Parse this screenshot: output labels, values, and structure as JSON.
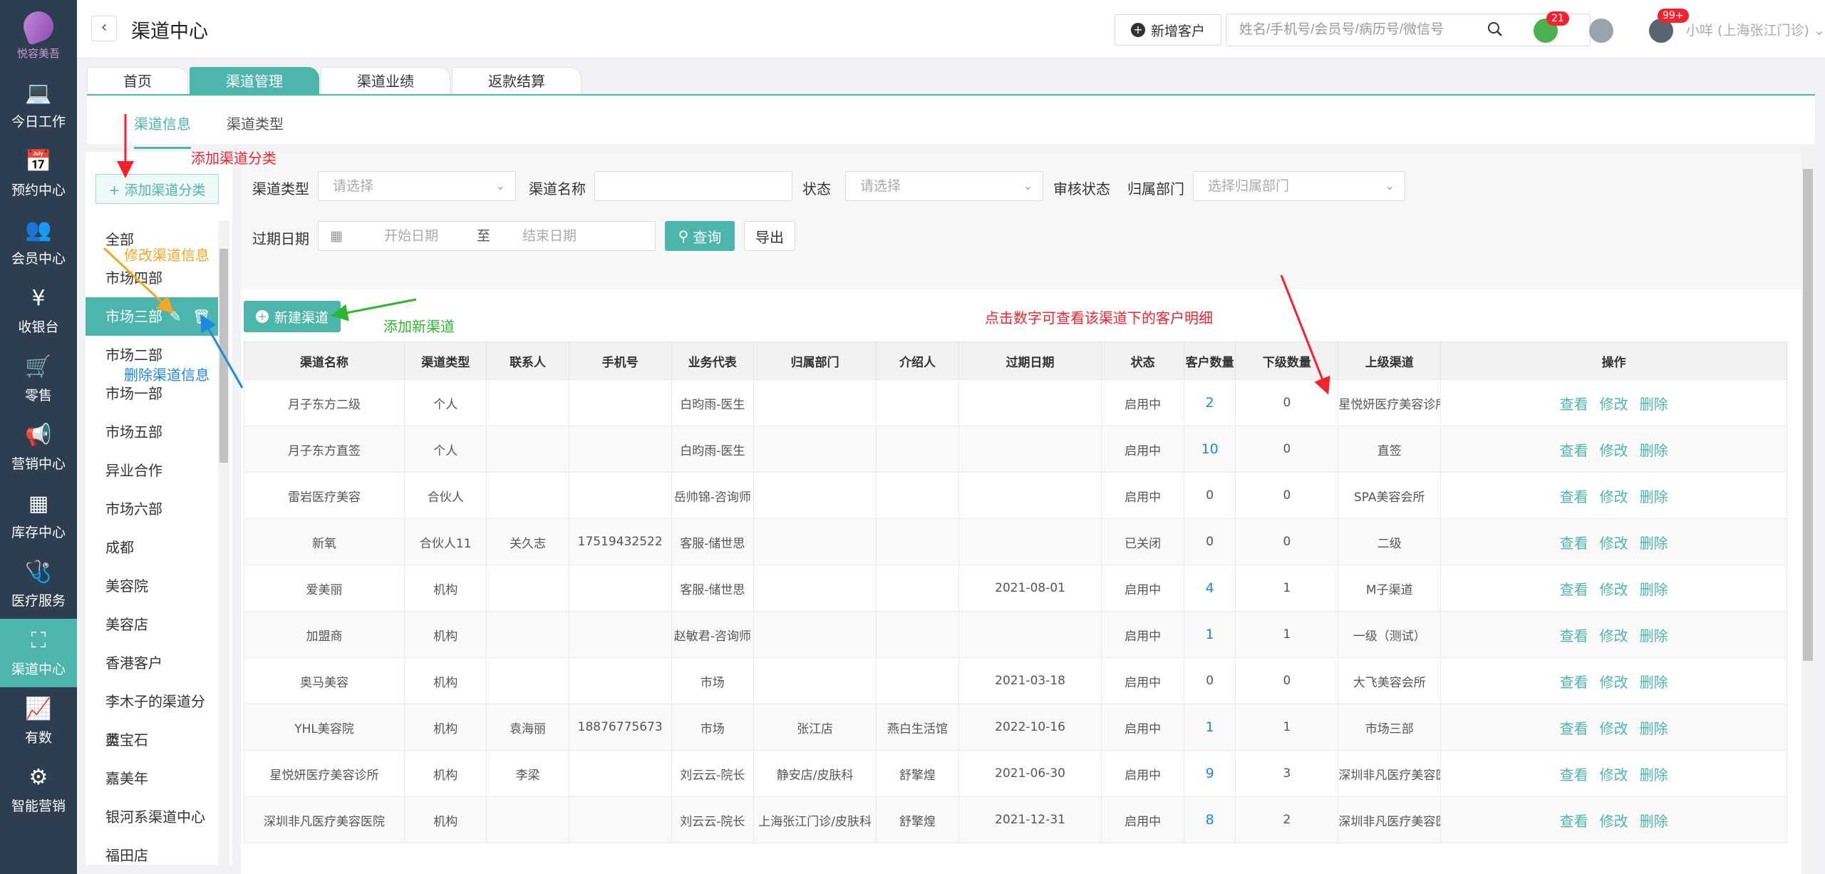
{
  "brand": {
    "logo_text": "悦容美吾"
  },
  "nav": [
    {
      "icon": "laptop-icon",
      "glyph": "💻",
      "label": "今日工作"
    },
    {
      "icon": "calendar-icon",
      "glyph": "📅",
      "label": "预约中心"
    },
    {
      "icon": "members-icon",
      "glyph": "👥",
      "label": "会员中心"
    },
    {
      "icon": "yen-icon",
      "glyph": "¥",
      "label": "收银台"
    },
    {
      "icon": "cart-icon",
      "glyph": "🛒",
      "label": "零售"
    },
    {
      "icon": "megaphone-icon",
      "glyph": "📢",
      "label": "营销中心"
    },
    {
      "icon": "grid-icon",
      "glyph": "▦",
      "label": "库存中心"
    },
    {
      "icon": "medical-kit-icon",
      "glyph": "🩺",
      "label": "医疗服务"
    },
    {
      "icon": "org-chart-icon",
      "glyph": "⛶",
      "label": "渠道中心"
    },
    {
      "icon": "trend-chart-icon",
      "glyph": "📈",
      "label": "有数"
    },
    {
      "icon": "smart-marketing-icon",
      "glyph": "⚙",
      "label": "智能营销"
    }
  ],
  "header": {
    "title": "渠道中心",
    "new_customer": "新增客户",
    "search_placeholder": "姓名/手机号/会员号/病历号/微信号",
    "badge_messages": "21",
    "badge_notifications": "99+",
    "user": "小咩 (上海张江门诊)"
  },
  "tabs": [
    "首页",
    "渠道管理",
    "渠道业绩",
    "返款结算"
  ],
  "subtabs": [
    "渠道信息",
    "渠道类型"
  ],
  "categories": {
    "add_button": "+ 添加渠道分类",
    "items": [
      "全部",
      "市场四部",
      "市场三部",
      "市场二部",
      "市场一部",
      "市场五部",
      "异业合作",
      "市场六部",
      "成都",
      "美容院",
      "美容店",
      "香港客户",
      "李木子的渠道分类",
      "蓝宝石",
      "嘉美年",
      "银河系渠道中心",
      "福田店"
    ]
  },
  "filters": {
    "type_label": "渠道类型",
    "type_placeholder": "请选择",
    "name_label": "渠道名称",
    "status_label": "状态",
    "status_placeholder": "请选择",
    "audit_label": "审核状态",
    "dept_label": "归属部门",
    "dept_placeholder": "选择归属部门",
    "expire_label": "过期日期",
    "start_placeholder": "开始日期",
    "to": "至",
    "end_placeholder": "结束日期",
    "query": "查询",
    "export": "导出"
  },
  "new_channel": "新建渠道",
  "table": {
    "headers": [
      "渠道名称",
      "渠道类型",
      "联系人",
      "手机号",
      "业务代表",
      "归属部门",
      "介绍人",
      "过期日期",
      "状态",
      "客户数量",
      "下级数量",
      "上级渠道",
      "操作"
    ],
    "actions": [
      "查看",
      "修改",
      "删除"
    ],
    "rows": [
      [
        "月子东方二级",
        "个人",
        "",
        "",
        "白昀雨-医生",
        "",
        "",
        "",
        "启用中",
        "2",
        "0",
        "星悦妍医疗美容诊所"
      ],
      [
        "月子东方直签",
        "个人",
        "",
        "",
        "白昀雨-医生",
        "",
        "",
        "",
        "启用中",
        "10",
        "0",
        "直签"
      ],
      [
        "雷岩医疗美容",
        "合伙人",
        "",
        "",
        "岳帅锦-咨询师",
        "",
        "",
        "",
        "启用中",
        "0",
        "0",
        "SPA美容会所"
      ],
      [
        "新氧",
        "合伙人11",
        "关久志",
        "17519432522",
        "客服-储世思",
        "",
        "",
        "",
        "已关闭",
        "0",
        "0",
        "二级"
      ],
      [
        "爱美丽",
        "机构",
        "",
        "",
        "客服-储世思",
        "",
        "",
        "2021-08-01",
        "启用中",
        "4",
        "1",
        "M子渠道"
      ],
      [
        "加盟商",
        "机构",
        "",
        "",
        "赵敏君-咨询师",
        "",
        "",
        "",
        "启用中",
        "1",
        "1",
        "一级（测试）"
      ],
      [
        "奥马美容",
        "机构",
        "",
        "",
        "市场",
        "",
        "",
        "2021-03-18",
        "启用中",
        "0",
        "0",
        "大飞美容会所"
      ],
      [
        "YHL美容院",
        "机构",
        "袁海丽",
        "18876775673",
        "市场",
        "张江店",
        "燕白生活馆",
        "2022-10-16",
        "启用中",
        "1",
        "1",
        "市场三部"
      ],
      [
        "星悦妍医疗美容诊所",
        "机构",
        "李梁",
        "",
        "刘云云-院长",
        "静安店/皮肤科",
        "舒擎煌",
        "2021-06-30",
        "启用中",
        "9",
        "3",
        "深圳非凡医疗美容医院"
      ],
      [
        "深圳非凡医疗美容医院",
        "机构",
        "",
        "",
        "刘云云-院长",
        "上海张江门诊/皮肤科",
        "舒擎煌",
        "2021-12-31",
        "启用中",
        "8",
        "2",
        "深圳非凡医疗美容医院"
      ]
    ]
  },
  "annotations": {
    "add_category": "添加渠道分类",
    "edit_channel_info": "修改渠道信息",
    "delete_channel_info": "删除渠道信息",
    "add_new_channel": "添加新渠道",
    "click_number_hint": "点击数字可查看该渠道下的客户明细"
  },
  "colors": {
    "accent": "#4db6ac",
    "nav_bg": "#2c3e50",
    "link": "#1e88e5",
    "anno_red": "#f5222d",
    "anno_orange": "#f5a623",
    "anno_blue": "#1e88e5",
    "anno_green": "#2db82d"
  }
}
